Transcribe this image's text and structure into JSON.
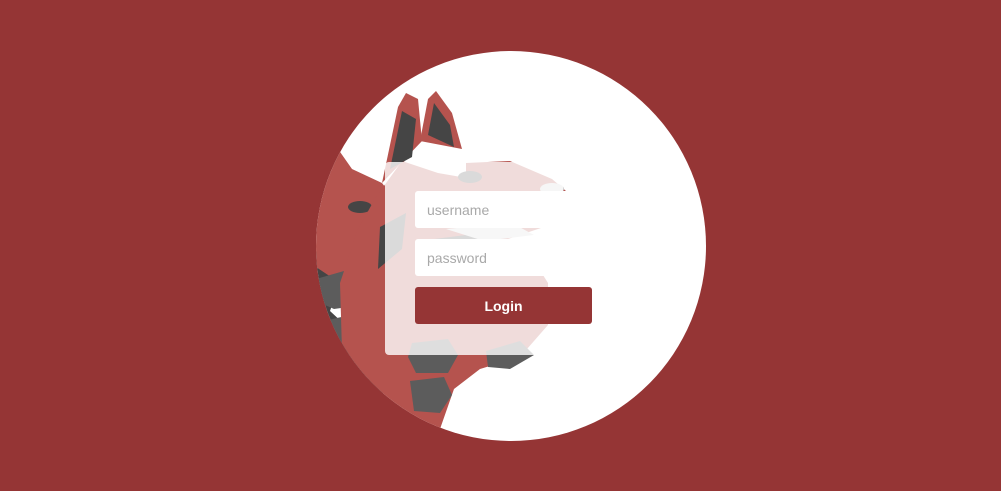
{
  "colors": {
    "background": "#953535",
    "circle": "#ffffff",
    "mascot_red": "#b5534e",
    "mascot_dark": "#454545",
    "mascot_grey": "#5c5c5c",
    "button": "#953535",
    "button_text": "#ffffff"
  },
  "mascot": {
    "icon": "fox-mascot-icon"
  },
  "login": {
    "username_placeholder": "username",
    "password_placeholder": "password",
    "button_label": "Login"
  }
}
